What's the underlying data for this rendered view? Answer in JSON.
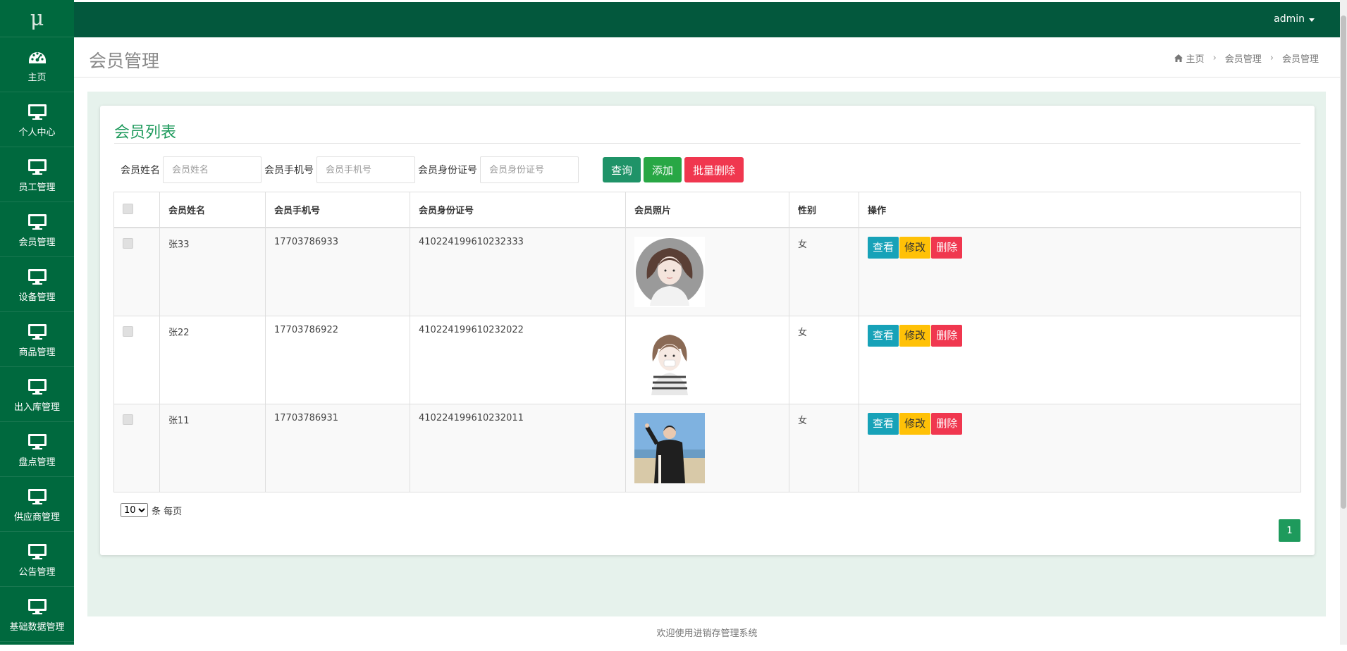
{
  "logo": "μ",
  "sidebar": {
    "items": [
      {
        "label": "主页",
        "icon": "dashboard-icon"
      },
      {
        "label": "个人中心",
        "icon": "monitor-icon"
      },
      {
        "label": "员工管理",
        "icon": "monitor-icon"
      },
      {
        "label": "会员管理",
        "icon": "monitor-icon"
      },
      {
        "label": "设备管理",
        "icon": "monitor-icon"
      },
      {
        "label": "商品管理",
        "icon": "monitor-icon"
      },
      {
        "label": "出入库管理",
        "icon": "monitor-icon"
      },
      {
        "label": "盘点管理",
        "icon": "monitor-icon"
      },
      {
        "label": "供应商管理",
        "icon": "monitor-icon"
      },
      {
        "label": "公告管理",
        "icon": "monitor-icon"
      },
      {
        "label": "基础数据管理",
        "icon": "monitor-icon"
      }
    ]
  },
  "topbar": {
    "user": "admin"
  },
  "header": {
    "title": "会员管理",
    "breadcrumb": [
      "主页",
      "会员管理",
      "会员管理"
    ]
  },
  "panel": {
    "title": "会员列表"
  },
  "search": {
    "name_label": "会员姓名",
    "name_placeholder": "会员姓名",
    "phone_label": "会员手机号",
    "phone_placeholder": "会员手机号",
    "id_label": "会员身份证号",
    "id_placeholder": "会员身份证号",
    "query_label": "查询",
    "add_label": "添加",
    "batch_delete_label": "批量删除"
  },
  "table": {
    "headers": [
      "会员姓名",
      "会员手机号",
      "会员身份证号",
      "会员照片",
      "性别",
      "操作"
    ],
    "rows": [
      {
        "name": "张33",
        "phone": "17703786933",
        "id": "410224199610232333",
        "gender": "女"
      },
      {
        "name": "张22",
        "phone": "17703786922",
        "id": "410224199610232022",
        "gender": "女"
      },
      {
        "name": "张11",
        "phone": "17703786931",
        "id": "410224199610232011",
        "gender": "女"
      }
    ],
    "actions": {
      "view": "查看",
      "edit": "修改",
      "delete": "删除"
    }
  },
  "pagination": {
    "page_size": "10",
    "page_size_options": [
      "10"
    ],
    "per_page_label": "条 每页",
    "current_page": "1"
  },
  "footer": {
    "text": "欢迎使用进销存管理系统"
  },
  "colors": {
    "sidebar": "#00693e",
    "topbar": "#03583d",
    "accent": "#1e9a5c",
    "view": "#17a2b8",
    "edit": "#ffc107",
    "delete": "#f0374f"
  }
}
